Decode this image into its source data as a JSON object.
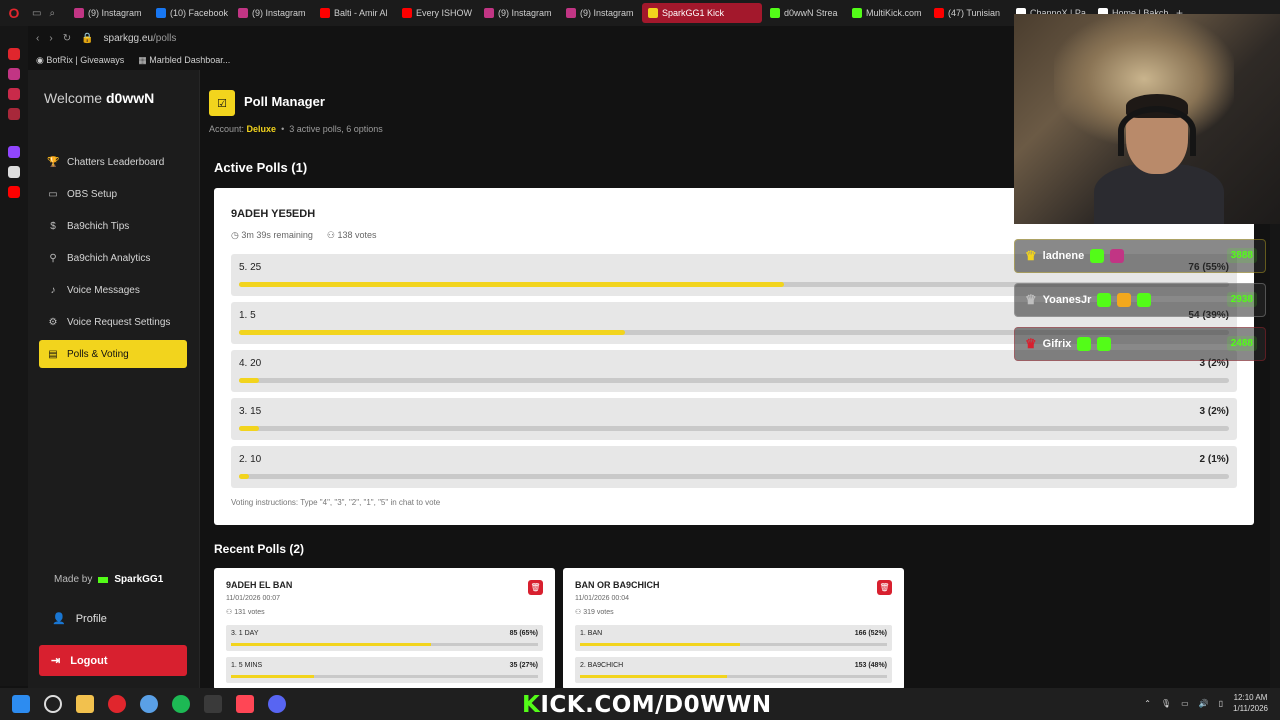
{
  "browser": {
    "tabs": [
      {
        "label": "(9) Instagram",
        "color": "#c13584"
      },
      {
        "label": "(10) Facebook",
        "color": "#1877f2"
      },
      {
        "label": "(9) Instagram",
        "color": "#c13584"
      },
      {
        "label": "Balti - Amir Al",
        "color": "#ff0000"
      },
      {
        "label": "Every ISHOW",
        "color": "#ff0000"
      },
      {
        "label": "(9) Instagram",
        "color": "#c13584"
      },
      {
        "label": "(9) Instagram",
        "color": "#c13584"
      },
      {
        "label": "SparkGG1 Kick",
        "color": "#f2d41d",
        "active": true
      },
      {
        "label": "d0wwN Strea",
        "color": "#53fc18"
      },
      {
        "label": "MultiKick.com",
        "color": "#53fc18"
      },
      {
        "label": "(47) Tunisian",
        "color": "#ff0000"
      },
      {
        "label": "ChannoX | Pa",
        "color": "#ffffff"
      },
      {
        "label": "Home | Bakch",
        "color": "#ffffff"
      }
    ],
    "url_domain": "sparkgg.eu",
    "url_path": "/polls",
    "bookmarks": [
      "BotRix | Giveaways",
      "Marbled Dashboar..."
    ]
  },
  "sidebar": {
    "welcome_prefix": "Welcome",
    "username": "d0wwN",
    "nav": [
      {
        "label": "Chatters Leaderboard",
        "icon": "trophy-icon",
        "glyph": "🏆"
      },
      {
        "label": "OBS Setup",
        "icon": "monitor-icon",
        "glyph": "▭"
      },
      {
        "label": "Ba9chich Tips",
        "icon": "dollar-icon",
        "glyph": "$"
      },
      {
        "label": "Ba9chich Analytics",
        "icon": "analytics-icon",
        "glyph": "⚲"
      },
      {
        "label": "Voice Messages",
        "icon": "mic-icon",
        "glyph": "♪"
      },
      {
        "label": "Voice Request Settings",
        "icon": "gear-icon",
        "glyph": "⚙"
      },
      {
        "label": "Polls & Voting",
        "icon": "poll-icon",
        "glyph": "▤",
        "active": true
      }
    ],
    "made_by_prefix": "Made by",
    "made_by_name": "SparkGG1",
    "profile_label": "Profile",
    "logout_label": "Logout"
  },
  "header": {
    "title": "Poll Manager",
    "account_prefix": "Account:",
    "account_tier": "Deluxe",
    "summary": "3 active polls, 6 options"
  },
  "active_polls": {
    "heading": "Active Polls (1)",
    "poll": {
      "title": "9ADEH YE5EDH",
      "remaining": "3m 39s remaining",
      "votes": "138 votes",
      "options": [
        {
          "label": "5. 25",
          "count": "76 (55%)",
          "pct": 55
        },
        {
          "label": "1. 5",
          "count": "54 (39%)",
          "pct": 39
        },
        {
          "label": "4. 20",
          "count": "3 (2%)",
          "pct": 2
        },
        {
          "label": "3. 15",
          "count": "3 (2%)",
          "pct": 2
        },
        {
          "label": "2. 10",
          "count": "2 (1%)",
          "pct": 1
        }
      ],
      "instructions": "Voting instructions: Type \"4\", \"3\", \"2\", \"1\", \"5\" in chat to vote"
    }
  },
  "recent_polls": {
    "heading": "Recent Polls (2)",
    "polls": [
      {
        "title": "9ADEH EL BAN",
        "date": "11/01/2026 00:07",
        "votes": "131 votes",
        "options": [
          {
            "label": "3. 1 DAY",
            "count": "85 (65%)",
            "pct": 65
          },
          {
            "label": "1. 5 MINS",
            "count": "35 (27%)",
            "pct": 27
          }
        ]
      },
      {
        "title": "BAN OR BA9CHICH",
        "date": "11/01/2026 00:04",
        "votes": "319 votes",
        "options": [
          {
            "label": "1. BAN",
            "count": "166 (52%)",
            "pct": 52
          },
          {
            "label": "2. BA9CHICH",
            "count": "153 (48%)",
            "pct": 48
          }
        ]
      }
    ]
  },
  "overlay": {
    "leaderboard": [
      {
        "name": "ladnene",
        "points": "3888",
        "color": "#f2d41d"
      },
      {
        "name": "YoanesJr",
        "points": "2938",
        "color": "#bfbfbf"
      },
      {
        "name": "Gifrix",
        "points": "2488",
        "color": "#d8202f"
      }
    ],
    "banner_k": "K",
    "banner_rest": "ICK.COM/D0WWN"
  },
  "taskbar": {
    "time": "12:10 AM",
    "date": "1/11/2026"
  }
}
